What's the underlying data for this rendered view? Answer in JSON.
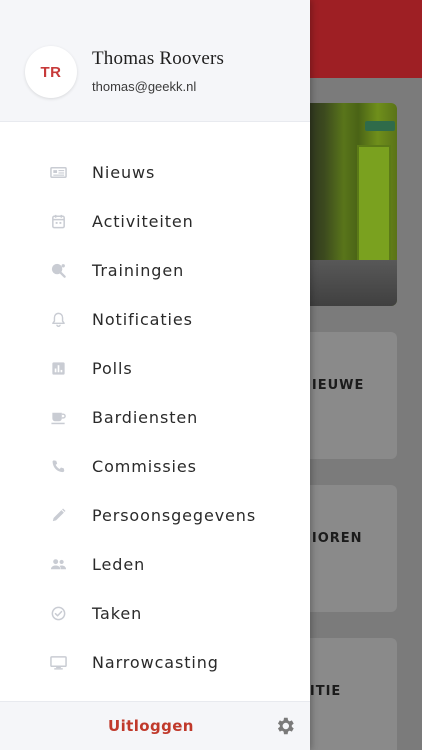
{
  "user": {
    "initials": "TR",
    "name": "Thomas Roovers",
    "email": "thomas@geekk.nl"
  },
  "menu": [
    {
      "label": "Nieuws",
      "icon": "newspaper-icon"
    },
    {
      "label": "Activiteiten",
      "icon": "calendar-icon"
    },
    {
      "label": "Trainingen",
      "icon": "table-tennis-icon"
    },
    {
      "label": "Notificaties",
      "icon": "bell-icon"
    },
    {
      "label": "Polls",
      "icon": "poll-chart-icon"
    },
    {
      "label": "Bardiensten",
      "icon": "coffee-cup-icon"
    },
    {
      "label": "Commissies",
      "icon": "phone-icon"
    },
    {
      "label": "Persoonsgegevens",
      "icon": "pencil-icon"
    },
    {
      "label": "Leden",
      "icon": "people-icon"
    },
    {
      "label": "Taken",
      "icon": "check-circle-icon"
    },
    {
      "label": "Narrowcasting",
      "icon": "monitor-icon"
    }
  ],
  "footer": {
    "logout_label": "Uitloggen",
    "settings_icon": "gear-icon"
  },
  "background": {
    "cards": [
      "NIEUWE",
      "NIOREN",
      "TITIE"
    ]
  },
  "colors": {
    "brand_red": "#c0392b",
    "header_red": "#9e1f24",
    "icon_gray": "#c9ccd3"
  }
}
